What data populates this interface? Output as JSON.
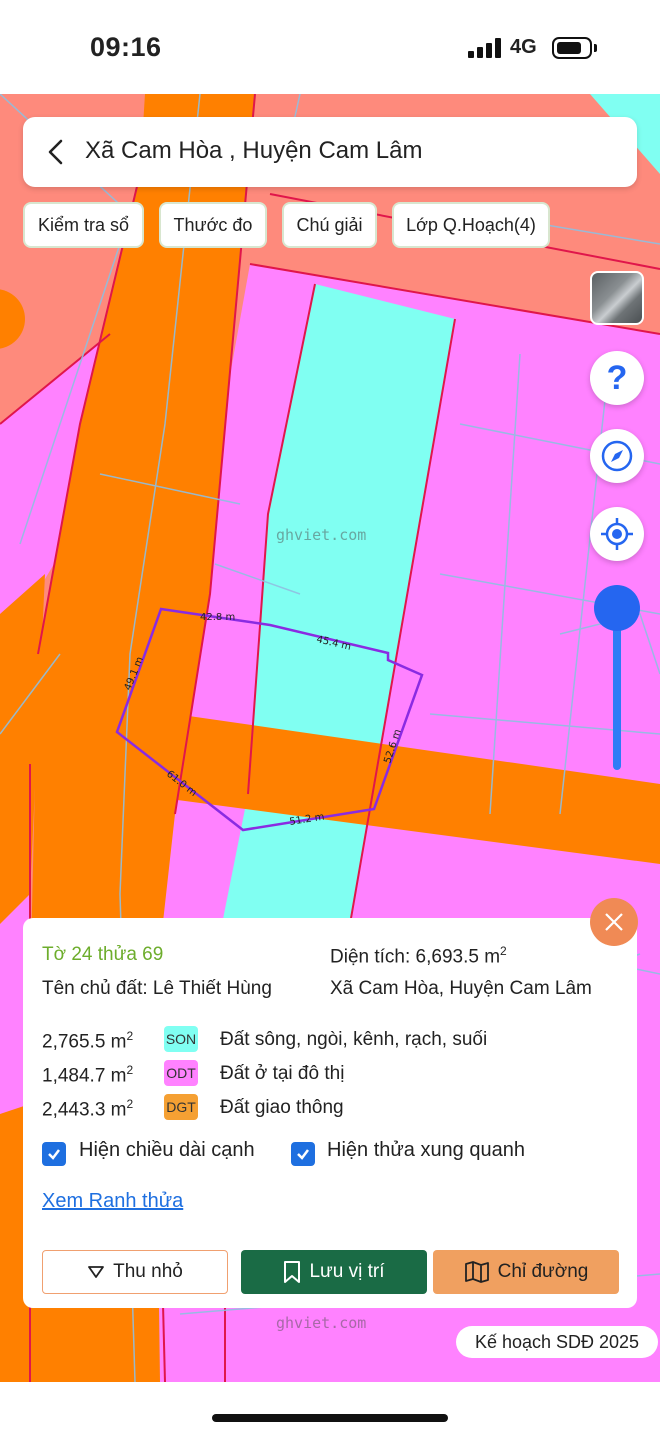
{
  "status": {
    "time": "09:16",
    "network": "4G"
  },
  "header": {
    "title": "Xã Cam Hòa , Huyện Cam Lâm"
  },
  "toolbar": {
    "chips": [
      "Kiểm tra sổ",
      "Thước đo",
      "Chú giải",
      "Lớp Q.Hoạch(4)"
    ]
  },
  "map": {
    "watermark": "ghviet.com",
    "edge_labels": [
      "42.8 m",
      "45.4 m",
      "52.6 m",
      "51.2 m",
      "61.0 m",
      "49.1 m"
    ],
    "colors": {
      "river": "#80fff2",
      "urban": "#ff82ff",
      "road": "#ff8000",
      "other": "#fe8a7c",
      "boundary": "#8a2be2"
    }
  },
  "controls": {
    "help": "?"
  },
  "parcel": {
    "id_text": "Tờ 24 thửa 69",
    "area_label": "Diện tích: 6,693.5 m",
    "area_sup": "2",
    "owner": "Tên chủ đất: Lê Thiết Hùng",
    "location": "Xã Cam Hòa, Huyện Cam Lâm",
    "land_uses": [
      {
        "area": "2,765.5 m",
        "sup": "2",
        "code": "SON",
        "desc": "Đất sông, ngòi, kênh, rạch, suối",
        "color": "#80fff2"
      },
      {
        "area": "1,484.7 m",
        "sup": "2",
        "code": "ODT",
        "desc": "Đất ở tại đô thị",
        "color": "#ff82ff"
      },
      {
        "area": "2,443.3 m",
        "sup": "2",
        "code": "DGT",
        "desc": "Đất giao thông",
        "color": "#f5a033"
      }
    ],
    "show_edge_length": "Hiện chiều dài cạnh",
    "show_neighbors": "Hiện thửa xung quanh",
    "view_boundary": "Xem Ranh thửa",
    "btn_collapse": "Thu nhỏ",
    "btn_save": "Lưu vị trí",
    "btn_directions": "Chỉ đường"
  },
  "plan_label": "Kế hoạch SDĐ 2025"
}
